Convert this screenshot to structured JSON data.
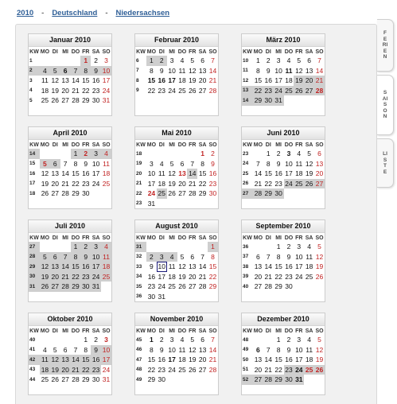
{
  "breadcrumb": {
    "year": "2010",
    "country": "Deutschland",
    "state": "Niedersachsen",
    "separator": "-"
  },
  "side_tabs": [
    "FERIEN",
    "SAISON",
    "LISTE"
  ],
  "weekday_header": [
    "KW",
    "MO",
    "DI",
    "MI",
    "DO",
    "FR",
    "SA",
    "SO"
  ],
  "months": [
    {
      "name": "Januar 2010",
      "weeks": [
        [
          "1",
          "",
          "",
          "",
          "",
          "1",
          "2",
          "3"
        ],
        [
          "2",
          "4",
          "5",
          "6",
          "7",
          "8",
          "9",
          "10"
        ],
        [
          "3",
          "11",
          "12",
          "13",
          "14",
          "15",
          "16",
          "17"
        ],
        [
          "4",
          "18",
          "19",
          "20",
          "21",
          "22",
          "23",
          "24"
        ],
        [
          "5",
          "25",
          "26",
          "27",
          "28",
          "29",
          "30",
          "31"
        ]
      ]
    },
    {
      "name": "Februar 2010",
      "weeks": [
        [
          "6",
          "1",
          "2",
          "3",
          "4",
          "5",
          "6",
          "7"
        ],
        [
          "7",
          "8",
          "9",
          "10",
          "11",
          "12",
          "13",
          "14"
        ],
        [
          "8",
          "15",
          "16",
          "17",
          "18",
          "19",
          "20",
          "21"
        ],
        [
          "9",
          "22",
          "23",
          "24",
          "25",
          "26",
          "27",
          "28"
        ]
      ]
    },
    {
      "name": "März 2010",
      "weeks": [
        [
          "10",
          "1",
          "2",
          "3",
          "4",
          "5",
          "6",
          "7"
        ],
        [
          "11",
          "8",
          "9",
          "10",
          "11",
          "12",
          "13",
          "14"
        ],
        [
          "12",
          "15",
          "16",
          "17",
          "18",
          "19",
          "20",
          "21"
        ],
        [
          "13",
          "22",
          "23",
          "24",
          "25",
          "26",
          "27",
          "28"
        ],
        [
          "14",
          "29",
          "30",
          "31",
          "",
          "",
          "",
          ""
        ]
      ]
    },
    {
      "name": "April 2010",
      "weeks": [
        [
          "14",
          "",
          "",
          "",
          "1",
          "2",
          "3",
          "4"
        ],
        [
          "15",
          "5",
          "6",
          "7",
          "8",
          "9",
          "10",
          "11"
        ],
        [
          "16",
          "12",
          "13",
          "14",
          "15",
          "16",
          "17",
          "18"
        ],
        [
          "17",
          "19",
          "20",
          "21",
          "22",
          "23",
          "24",
          "25"
        ],
        [
          "18",
          "26",
          "27",
          "28",
          "29",
          "30",
          "",
          ""
        ]
      ]
    },
    {
      "name": "Mai 2010",
      "weeks": [
        [
          "18",
          "",
          "",
          "",
          "",
          "",
          "1",
          "2"
        ],
        [
          "19",
          "3",
          "4",
          "5",
          "6",
          "7",
          "8",
          "9"
        ],
        [
          "20",
          "10",
          "11",
          "12",
          "13",
          "14",
          "15",
          "16"
        ],
        [
          "21",
          "17",
          "18",
          "19",
          "20",
          "21",
          "22",
          "23"
        ],
        [
          "22",
          "24",
          "25",
          "26",
          "27",
          "28",
          "29",
          "30"
        ],
        [
          "23",
          "31",
          "",
          "",
          "",
          "",
          "",
          ""
        ]
      ]
    },
    {
      "name": "Juni 2010",
      "weeks": [
        [
          "23",
          "",
          "1",
          "2",
          "3",
          "4",
          "5",
          "6"
        ],
        [
          "24",
          "7",
          "8",
          "9",
          "10",
          "11",
          "12",
          "13"
        ],
        [
          "25",
          "14",
          "15",
          "16",
          "17",
          "18",
          "19",
          "20"
        ],
        [
          "26",
          "21",
          "22",
          "23",
          "24",
          "25",
          "26",
          "27"
        ],
        [
          "27",
          "28",
          "29",
          "30",
          "",
          "",
          "",
          ""
        ]
      ]
    },
    {
      "name": "Juli 2010",
      "weeks": [
        [
          "27",
          "",
          "",
          "",
          "1",
          "2",
          "3",
          "4"
        ],
        [
          "28",
          "5",
          "6",
          "7",
          "8",
          "9",
          "10",
          "11"
        ],
        [
          "29",
          "12",
          "13",
          "14",
          "15",
          "16",
          "17",
          "18"
        ],
        [
          "30",
          "19",
          "20",
          "21",
          "22",
          "23",
          "24",
          "25"
        ],
        [
          "31",
          "26",
          "27",
          "28",
          "29",
          "30",
          "31",
          ""
        ]
      ]
    },
    {
      "name": "August 2010",
      "weeks": [
        [
          "31",
          "",
          "",
          "",
          "",
          "",
          "",
          "1"
        ],
        [
          "32",
          "2",
          "3",
          "4",
          "5",
          "6",
          "7",
          "8"
        ],
        [
          "33",
          "9",
          "10",
          "11",
          "12",
          "13",
          "14",
          "15"
        ],
        [
          "34",
          "16",
          "17",
          "18",
          "19",
          "20",
          "21",
          "22"
        ],
        [
          "35",
          "23",
          "24",
          "25",
          "26",
          "27",
          "28",
          "29"
        ],
        [
          "36",
          "30",
          "31",
          "",
          "",
          "",
          "",
          ""
        ]
      ]
    },
    {
      "name": "September 2010",
      "weeks": [
        [
          "36",
          "",
          "",
          "1",
          "2",
          "3",
          "4",
          "5"
        ],
        [
          "37",
          "6",
          "7",
          "8",
          "9",
          "10",
          "11",
          "12"
        ],
        [
          "38",
          "13",
          "14",
          "15",
          "16",
          "17",
          "18",
          "19"
        ],
        [
          "39",
          "20",
          "21",
          "22",
          "23",
          "24",
          "25",
          "26"
        ],
        [
          "40",
          "27",
          "28",
          "29",
          "30",
          "",
          "",
          ""
        ]
      ]
    },
    {
      "name": "Oktober 2010",
      "weeks": [
        [
          "40",
          "",
          "",
          "",
          "",
          "1",
          "2",
          "3"
        ],
        [
          "41",
          "4",
          "5",
          "6",
          "7",
          "8",
          "9",
          "10"
        ],
        [
          "42",
          "11",
          "12",
          "13",
          "14",
          "15",
          "16",
          "17"
        ],
        [
          "43",
          "18",
          "19",
          "20",
          "21",
          "22",
          "23",
          "24"
        ],
        [
          "44",
          "25",
          "26",
          "27",
          "28",
          "29",
          "30",
          "31"
        ]
      ]
    },
    {
      "name": "November 2010",
      "weeks": [
        [
          "45",
          "1",
          "2",
          "3",
          "4",
          "5",
          "6",
          "7"
        ],
        [
          "46",
          "8",
          "9",
          "10",
          "11",
          "12",
          "13",
          "14"
        ],
        [
          "47",
          "15",
          "16",
          "17",
          "18",
          "19",
          "20",
          "21"
        ],
        [
          "48",
          "22",
          "23",
          "24",
          "25",
          "26",
          "27",
          "28"
        ],
        [
          "49",
          "29",
          "30",
          "",
          "",
          "",
          "",
          ""
        ]
      ]
    },
    {
      "name": "Dezember 2010",
      "weeks": [
        [
          "48",
          "",
          "",
          "1",
          "2",
          "3",
          "4",
          "5"
        ],
        [
          "49",
          "6",
          "7",
          "8",
          "9",
          "10",
          "11",
          "12"
        ],
        [
          "50",
          "13",
          "14",
          "15",
          "16",
          "17",
          "18",
          "19"
        ],
        [
          "51",
          "20",
          "21",
          "22",
          "23",
          "24",
          "25",
          "26"
        ],
        [
          "52",
          "27",
          "28",
          "29",
          "30",
          "31",
          "",
          ""
        ]
      ]
    }
  ],
  "vacations": [
    "2010-01-01",
    "2010-01-04",
    "2010-01-05",
    "2010-01-06",
    "2010-01-07",
    "2010-01-08",
    "2010-01-09",
    "2010-01-10",
    "2010-02-01",
    "2010-02-02",
    "2010-03-19",
    "2010-03-20",
    "2010-03-21",
    "2010-03-22",
    "2010-03-23",
    "2010-03-24",
    "2010-03-25",
    "2010-03-26",
    "2010-03-27",
    "2010-03-28",
    "2010-03-29",
    "2010-03-30",
    "2010-03-31",
    "2010-04-01",
    "2010-04-02",
    "2010-04-03",
    "2010-04-04",
    "2010-04-05",
    "2010-04-06",
    "2010-05-14",
    "2010-05-25",
    "2010-06-24",
    "2010-06-25",
    "2010-06-26",
    "2010-06-27",
    "2010-06-28",
    "2010-06-29",
    "2010-06-30",
    "2010-07-01",
    "2010-07-02",
    "2010-07-03",
    "2010-07-04",
    "2010-07-05",
    "2010-07-06",
    "2010-07-07",
    "2010-07-08",
    "2010-07-09",
    "2010-07-10",
    "2010-07-11",
    "2010-07-12",
    "2010-07-13",
    "2010-07-14",
    "2010-07-15",
    "2010-07-16",
    "2010-07-17",
    "2010-07-18",
    "2010-07-19",
    "2010-07-20",
    "2010-07-21",
    "2010-07-22",
    "2010-07-23",
    "2010-07-24",
    "2010-07-25",
    "2010-07-26",
    "2010-07-27",
    "2010-07-28",
    "2010-07-29",
    "2010-07-30",
    "2010-07-31",
    "2010-08-01",
    "2010-08-02",
    "2010-08-03",
    "2010-08-04",
    "2010-10-09",
    "2010-10-10",
    "2010-10-11",
    "2010-10-12",
    "2010-10-13",
    "2010-10-14",
    "2010-10-15",
    "2010-10-16",
    "2010-10-17",
    "2010-10-18",
    "2010-10-19",
    "2010-10-20",
    "2010-10-21",
    "2010-10-22",
    "2010-10-23",
    "2010-12-23",
    "2010-12-24",
    "2010-12-25",
    "2010-12-26",
    "2010-12-27",
    "2010-12-28",
    "2010-12-29",
    "2010-12-30",
    "2010-12-31"
  ],
  "holidays": [
    "2010-01-01",
    "2010-04-02",
    "2010-04-05",
    "2010-05-01",
    "2010-05-13",
    "2010-05-24",
    "2010-10-03",
    "2010-12-25",
    "2010-12-26"
  ],
  "bold_days": [
    "2010-01-06",
    "2010-02-15",
    "2010-02-16",
    "2010-02-17",
    "2010-03-11",
    "2010-03-28",
    "2010-06-03",
    "2010-11-01",
    "2010-11-17",
    "2010-12-06",
    "2010-12-24",
    "2010-12-31"
  ],
  "today": "2010-08-10"
}
